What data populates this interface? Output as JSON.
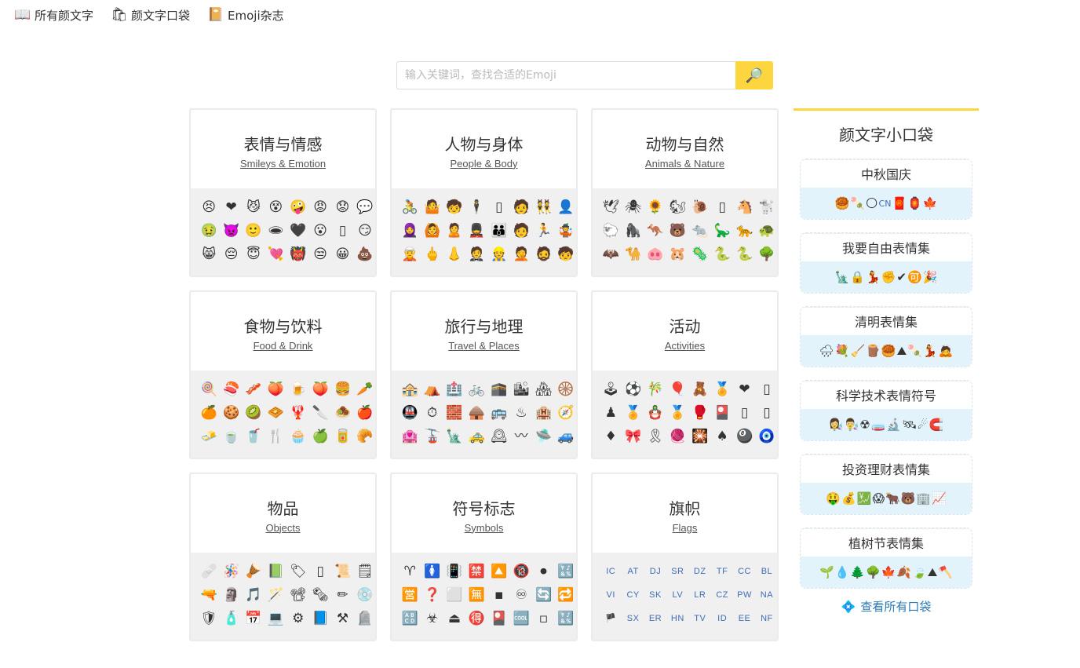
{
  "nav": [
    {
      "icon": "📖",
      "icon_name": "book-icon",
      "label": "所有颜文字"
    },
    {
      "icon": "🛍",
      "icon_name": "bag-icon",
      "label": "颜文字口袋"
    },
    {
      "icon": "📔",
      "icon_name": "magazine-icon",
      "label": "Emoji杂志"
    }
  ],
  "search": {
    "placeholder": "输入关键词，查找合适的Emoji",
    "button_icon": "🔎"
  },
  "categories": [
    {
      "zh": "表情与情感",
      "en": "Smileys & Emotion",
      "emojis": [
        "😣",
        "❤",
        "😼",
        "😵",
        "🤪",
        "😡",
        "😟",
        "💬",
        "🤢",
        "👿",
        "🙂",
        "🕳",
        "🖤",
        "😮",
        "▯",
        "😏",
        "😸",
        "😔",
        "😇",
        "💘",
        "👹",
        "😒",
        "😀",
        "💩"
      ]
    },
    {
      "zh": "人物与身体",
      "en": "People & Body",
      "emojis": [
        "🚴",
        "🤷",
        "🧒",
        "🕴",
        "▯",
        "🧑",
        "👯",
        "👤",
        "🧕",
        "🙆",
        "🙎",
        "💂",
        "👪",
        "🧑",
        "🏃",
        "🤹",
        "🧝",
        "🖕",
        "👃",
        "🤵",
        "👷",
        "🤦",
        "🧔",
        "🧒"
      ]
    },
    {
      "zh": "动物与自然",
      "en": "Animals & Nature",
      "emojis": [
        "🕊",
        "🕷",
        "🌻",
        "🐿",
        "🐌",
        "▯",
        "🐴",
        "🐩",
        "🐑",
        "🦍",
        "🦘",
        "🐻",
        "🐀",
        "🦕",
        "🐆",
        "🐢",
        "🦇",
        "🐪",
        "🐽",
        "🐹",
        "🦠",
        "🐍",
        "🐍",
        "🌳"
      ]
    },
    {
      "zh": "食物与饮料",
      "en": "Food & Drink",
      "emojis": [
        "🍭",
        "🍣",
        "🥓",
        "🍑",
        "🍺",
        "🍑",
        "🍔",
        "🥕",
        "🍊",
        "🍪",
        "🥝",
        "🧇",
        "🦞",
        "🔪",
        "🧆",
        "🍎",
        "🧈",
        "🍵",
        "🥤",
        "🍴",
        "🧁",
        "🍏",
        "🥫",
        "🥐"
      ]
    },
    {
      "zh": "旅行与地理",
      "en": "Travel & Places",
      "emojis": [
        "🏤",
        "⛺",
        "🏥",
        "🚲",
        "🕋",
        "🏙",
        "🏘",
        "🛞",
        "🚇",
        "⏱",
        "🧱",
        "🛖",
        "🚌",
        "♨",
        "🏨",
        "🧭",
        "🏩",
        "🚡",
        "🗽",
        "🚕",
        "🕰",
        "〰",
        "🛸",
        "🚙"
      ]
    },
    {
      "zh": "活动",
      "en": "Activities",
      "emojis": [
        "🕹",
        "⚽",
        "🎋",
        "🎈",
        "🧸",
        "🏅",
        "❤",
        "▯",
        "♟",
        "🏅",
        "🪆",
        "🏅",
        "🥊",
        "🎴",
        "▯",
        "▯",
        "♦",
        "🎀",
        "🎗",
        "🧶",
        "🎇",
        "♠",
        "🎱",
        "🧿"
      ]
    },
    {
      "zh": "物品",
      "en": "Objects",
      "emojis": [
        "🩹",
        "🪅",
        "🪘",
        "📗",
        "🏷",
        "▯",
        "📜",
        "🗒",
        "🔫",
        "🗿",
        "🎵",
        "🪄",
        "📽",
        "🗞",
        "✏",
        "💿",
        "🛡",
        "🧴",
        "📅",
        "💻",
        "⚙",
        "📘",
        "⚒",
        "🪦"
      ]
    },
    {
      "zh": "符号标志",
      "en": "Symbols",
      "emojis": [
        "♈",
        "🚺",
        "📳",
        "🈲",
        "🔼",
        "🔞",
        "⏺",
        "🔣",
        "🈺",
        "❓",
        "⬜",
        "🈚",
        "▪",
        "♾",
        "🔄",
        "🔁",
        "🔠",
        "☣",
        "⏏",
        "🉐",
        "🎴",
        "🆒",
        "▫",
        "🔣"
      ]
    },
    {
      "zh": "旗帜",
      "en": "Flags",
      "flags": true,
      "emojis": [
        "IC",
        "AT",
        "DJ",
        "SR",
        "DZ",
        "TF",
        "CC",
        "BL",
        "VI",
        "CY",
        "SK",
        "LV",
        "LR",
        "CZ",
        "PW",
        "NA",
        "🏴",
        "SX",
        "ER",
        "HN",
        "TV",
        "ID",
        "EE",
        "NF"
      ]
    }
  ],
  "sidebar": {
    "title": "颜文字小口袋",
    "pockets": [
      {
        "title": "中秋国庆",
        "emojis": [
          "🥮",
          "🍡",
          "🌕",
          "CN",
          "🧧",
          "🏮",
          "🍁"
        ]
      },
      {
        "title": "我要自由表情集",
        "emojis": [
          "🗽",
          "🔒",
          "💃",
          "✊",
          "✔",
          "🉑",
          "🎉"
        ]
      },
      {
        "title": "清明表情集",
        "emojis": [
          "🌧",
          "💐",
          "🧹",
          "🪵",
          "🥮",
          "⛰",
          "🍡",
          "💃",
          "🙇"
        ]
      },
      {
        "title": "科学技术表情符号",
        "emojis": [
          "👩‍🔬",
          "👨‍🔬",
          "☢",
          "🧫",
          "🔬",
          "🛰",
          "☄",
          "🧲"
        ]
      },
      {
        "title": "投资理财表情集",
        "emojis": [
          "🤑",
          "💰",
          "💹",
          "😱",
          "🐂",
          "🐻",
          "🏢",
          "📈"
        ]
      },
      {
        "title": "植树节表情集",
        "emojis": [
          "🌱",
          "💧",
          "🌲",
          "🌳",
          "🍁",
          "🍂",
          "🍃",
          "⛰",
          "🪓"
        ]
      }
    ],
    "view_all": "查看所有口袋",
    "view_all_icon": "💠"
  }
}
